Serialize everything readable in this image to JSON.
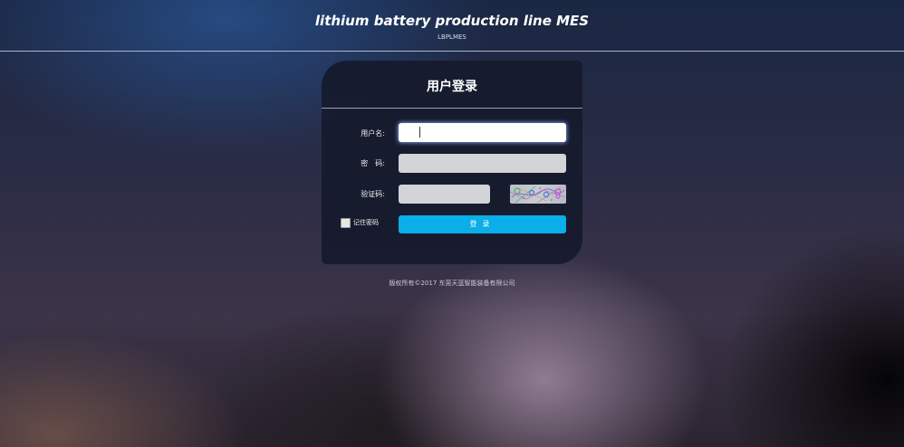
{
  "header": {
    "title": "lithium battery production line MES",
    "subtitle": "LBPLMES"
  },
  "login": {
    "title": "用户登录",
    "username_label": "用户名:",
    "username_value": "",
    "password_label": "密　码:",
    "password_value": "",
    "captcha_label": "验证码:",
    "captcha_value": "",
    "remember_label": "记住密码",
    "remember_checked": false,
    "submit_label": "登录"
  },
  "footer": {
    "copyright": "版权所有©2017 东莞天蓝智能装备有限公司"
  },
  "colors": {
    "accent": "#0aaee8",
    "panel": "#161a2c",
    "input": "#d3d4d8"
  }
}
